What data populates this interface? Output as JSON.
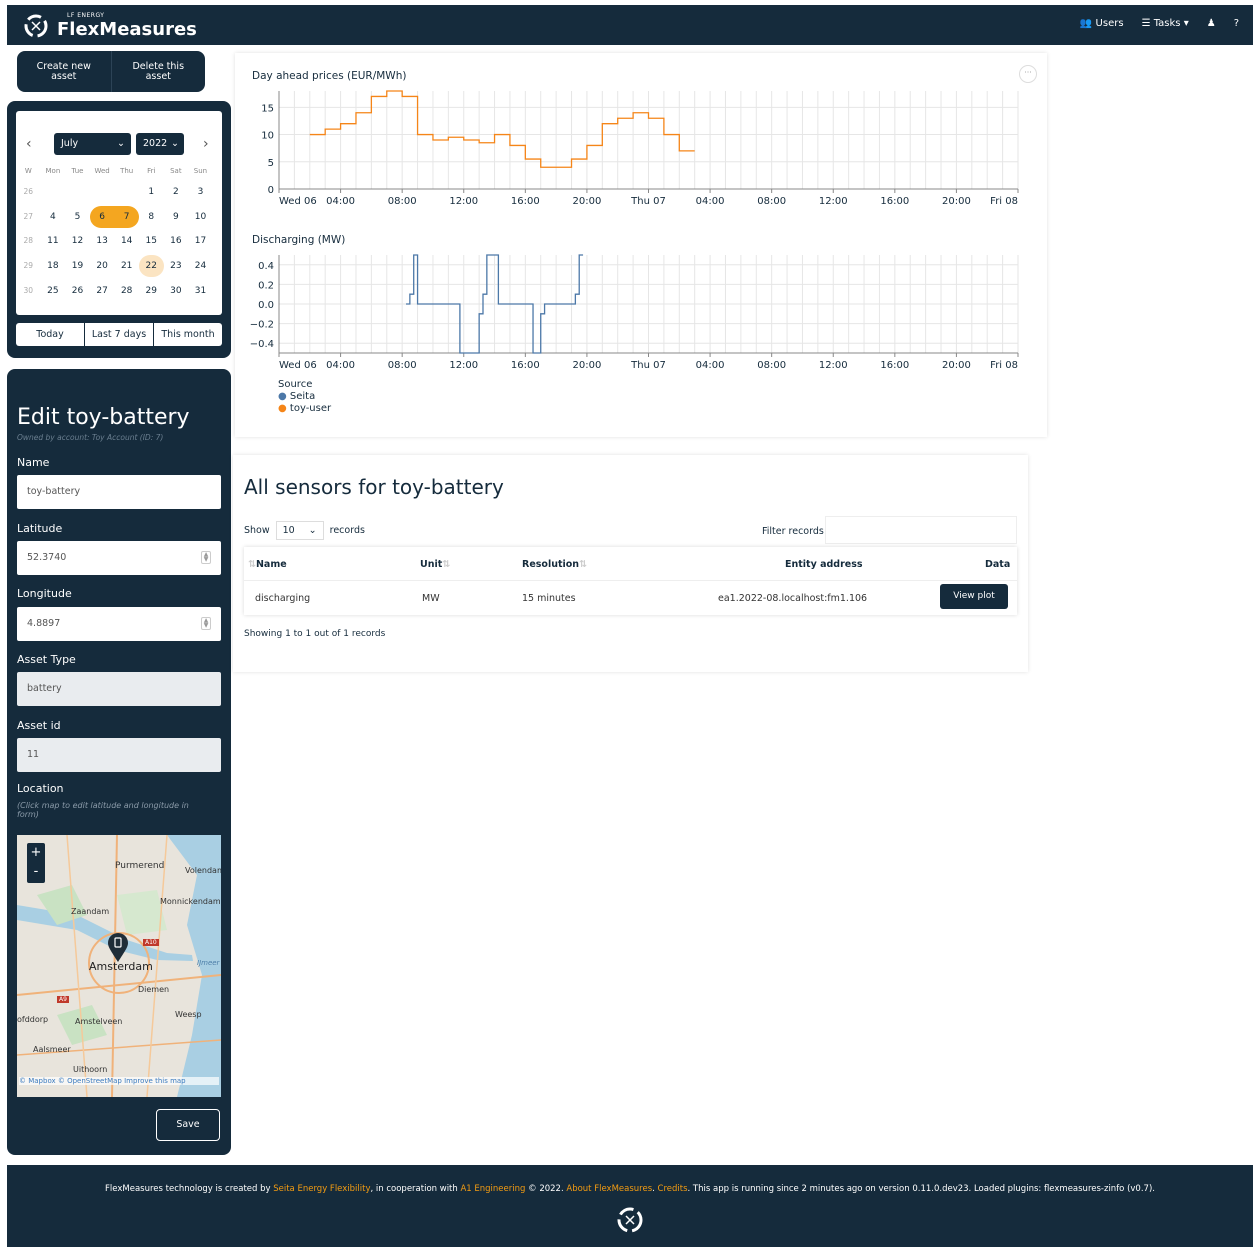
{
  "header": {
    "brand_small": "LF ENERGY",
    "brand": "FlexMeasures",
    "nav": {
      "users": "Users",
      "tasks": "Tasks ▾",
      "user_icon": "♟",
      "help": "?"
    }
  },
  "asset_buttons": {
    "create": "Create new asset",
    "delete": "Delete this asset"
  },
  "calendar": {
    "month": "July",
    "year": "2022",
    "days_of_week": [
      "W",
      "Mon",
      "Tue",
      "Wed",
      "Thu",
      "Fri",
      "Sat",
      "Sun"
    ],
    "weeks": [
      [
        "26",
        "",
        "",
        "",
        "",
        "1",
        "2",
        "3"
      ],
      [
        "27",
        "4",
        "5",
        "6",
        "7",
        "8",
        "9",
        "10"
      ],
      [
        "28",
        "11",
        "12",
        "13",
        "14",
        "15",
        "16",
        "17"
      ],
      [
        "29",
        "18",
        "19",
        "20",
        "21",
        "22",
        "23",
        "24"
      ],
      [
        "30",
        "25",
        "26",
        "27",
        "28",
        "29",
        "30",
        "31"
      ]
    ],
    "selected": [
      "6",
      "7"
    ],
    "today": "22",
    "quick": [
      "Today",
      "Last 7 days",
      "This month"
    ],
    "colors": {
      "selected": "#f4a620",
      "today": "#fbe4c2"
    }
  },
  "edit": {
    "title": "Edit toy-battery",
    "owned": "Owned by account: Toy Account (ID: 7)",
    "name_label": "Name",
    "name_value": "toy-battery",
    "lat_label": "Latitude",
    "lat_value": "52.3740",
    "lon_label": "Longitude",
    "lon_value": "4.8897",
    "type_label": "Asset Type",
    "type_value": "battery",
    "id_label": "Asset id",
    "id_value": "11",
    "loc_label": "Location",
    "loc_hint": "(Click map to edit latitude and longitude in form)",
    "save": "Save",
    "map_labels": {
      "purmerend": "Purmerend",
      "volendam": "Volendam",
      "monnickendam": "Monnickendam",
      "zaandam": "Zaandam",
      "amsterdam": "Amsterdam",
      "diemen": "Diemen",
      "weesp": "Weesp",
      "amstelveen": "Amstelveen",
      "hoofddorp": "ofddorp",
      "aalsmeer": "Aalsmeer",
      "uithoorn": "Uithoorn",
      "ijmeer": "IJmeer",
      "a10": "A10",
      "a9": "A9",
      "attribution": "© Mapbox © OpenStreetMap Improve this map"
    },
    "zoom": {
      "in": "+",
      "out": "-"
    }
  },
  "chart_data": [
    {
      "type": "line",
      "title": "Day ahead prices (EUR/MWh)",
      "x_ticks": [
        "Wed 06",
        "04:00",
        "08:00",
        "12:00",
        "16:00",
        "20:00",
        "Thu 07",
        "04:00",
        "08:00",
        "12:00",
        "16:00",
        "20:00",
        "Fri 08"
      ],
      "y_ticks": [
        "15",
        "10",
        "5",
        "0"
      ],
      "ylim": [
        0,
        18
      ],
      "series": [
        {
          "name": "toy-user",
          "color": "#f58518",
          "x_hours": [
            2,
            3,
            4,
            5,
            6,
            7,
            8,
            9,
            10,
            11,
            12,
            13,
            14,
            15,
            16,
            17,
            18,
            19,
            20,
            21,
            22,
            23,
            24,
            25,
            26
          ],
          "values": [
            10,
            11,
            12,
            14,
            17,
            18,
            17,
            10,
            9,
            9.5,
            9,
            8.5,
            10,
            8,
            5.5,
            4,
            4,
            5.5,
            8,
            12,
            13,
            14,
            13,
            10,
            7
          ]
        }
      ]
    },
    {
      "type": "line",
      "title": "Discharging (MW)",
      "x_ticks": [
        "Wed 06",
        "04:00",
        "08:00",
        "12:00",
        "16:00",
        "20:00",
        "Thu 07",
        "04:00",
        "08:00",
        "12:00",
        "16:00",
        "20:00",
        "Fri 08"
      ],
      "y_ticks": [
        "0.4",
        "0.2",
        "0.0",
        "−0.2",
        "−0.4"
      ],
      "ylim": [
        -0.5,
        0.5
      ],
      "series": [
        {
          "name": "Seita",
          "color": "#4c78a8",
          "points": [
            [
              8.25,
              0
            ],
            [
              8.5,
              0
            ],
            [
              8.5,
              0.1
            ],
            [
              8.75,
              0.1
            ],
            [
              8.75,
              0.5
            ],
            [
              9,
              0.5
            ],
            [
              9,
              0
            ],
            [
              11.75,
              0
            ],
            [
              11.75,
              -0.5
            ],
            [
              13,
              -0.5
            ],
            [
              13,
              -0.1
            ],
            [
              13.25,
              -0.1
            ],
            [
              13.25,
              0.1
            ],
            [
              13.5,
              0.1
            ],
            [
              13.5,
              0.5
            ],
            [
              14.25,
              0.5
            ],
            [
              14.25,
              0
            ],
            [
              16.5,
              0
            ],
            [
              16.5,
              -0.5
            ],
            [
              17,
              -0.5
            ],
            [
              17,
              -0.1
            ],
            [
              17.25,
              -0.1
            ],
            [
              17.25,
              0
            ],
            [
              19.25,
              0
            ],
            [
              19.25,
              0.1
            ],
            [
              19.5,
              0.1
            ],
            [
              19.5,
              0.5
            ],
            [
              19.75,
              0.5
            ]
          ]
        }
      ]
    }
  ],
  "legend": {
    "title": "Source",
    "items": [
      {
        "label": "Seita",
        "color": "#4c78a8"
      },
      {
        "label": "toy-user",
        "color": "#f58518"
      }
    ]
  },
  "sensors": {
    "title": "All sensors for toy-battery",
    "show": "Show",
    "page_size": "10",
    "records": "records",
    "filter": "Filter records:",
    "columns": [
      "Name",
      "Unit",
      "Resolution",
      "Entity address",
      "Data"
    ],
    "rows": [
      {
        "name": "discharging",
        "unit": "MW",
        "resolution": "15 minutes",
        "address": "ea1.2022-08.localhost:fm1.106",
        "action": "View plot"
      }
    ],
    "info": "Showing 1 to 1 out of 1 records"
  },
  "footer": {
    "p1": "FlexMeasures technology is created by ",
    "seita": "Seita Energy Flexibility",
    "p2": ", in cooperation with ",
    "a1": "A1 Engineering",
    "p3": " © 2022. ",
    "about": "About FlexMeasures",
    "p4": ". ",
    "credits": "Credits",
    "p5": ". This app is running since 2 minutes ago on version 0.11.0.dev23. Loaded plugins: flexmeasures-zinfo (v0.7)."
  }
}
